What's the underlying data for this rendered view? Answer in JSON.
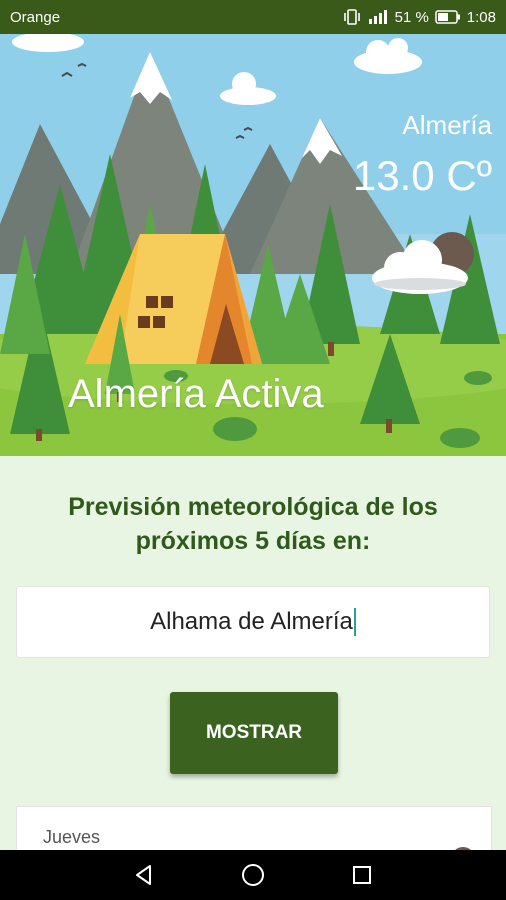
{
  "status_bar": {
    "carrier": "Orange",
    "battery": "51 %",
    "time": "1:08"
  },
  "header": {
    "city": "Almería",
    "temperature": "13.0 Cº",
    "app_title": "Almería Activa"
  },
  "forecast": {
    "heading_line1": "Previsión meteorológica de los",
    "heading_line2": "próximos 5 días en:",
    "location_value": "Alhama de Almería",
    "show_button": "MOSTRAR"
  },
  "days": [
    {
      "label": "Jueves"
    }
  ],
  "icons": {
    "weather": "cloud-sun-icon",
    "back": "back-icon",
    "home": "home-icon",
    "recents": "recents-icon"
  },
  "colors": {
    "status_bar": "#3a5a1a",
    "heading": "#2f5a1b",
    "button": "#3c6220",
    "background": "#e9f5e3"
  }
}
